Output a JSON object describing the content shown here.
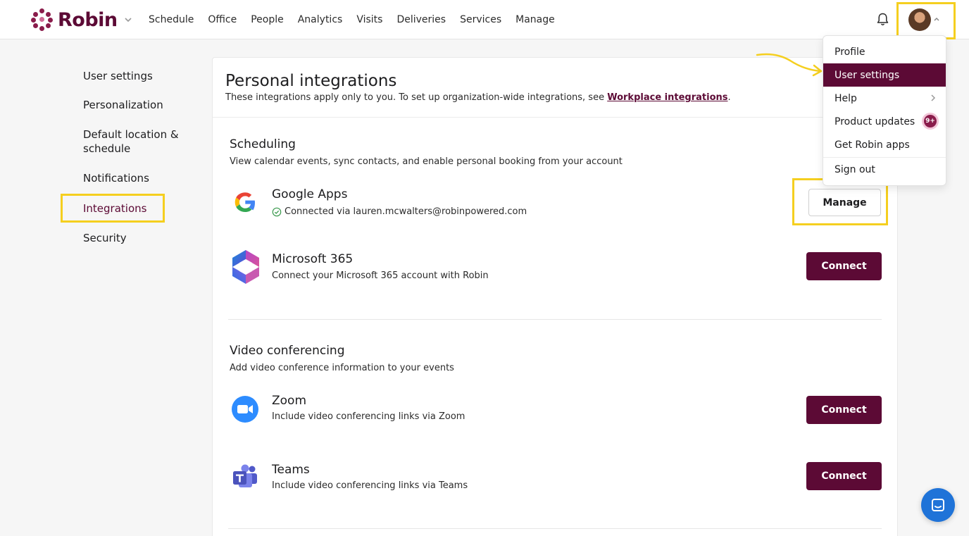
{
  "app": {
    "name": "Robin"
  },
  "nav": [
    "Schedule",
    "Office",
    "People",
    "Analytics",
    "Visits",
    "Deliveries",
    "Services",
    "Manage"
  ],
  "sidebar": {
    "items": [
      {
        "label": "User settings"
      },
      {
        "label": "Personalization"
      },
      {
        "label": "Default location & schedule"
      },
      {
        "label": "Notifications"
      },
      {
        "label": "Integrations"
      },
      {
        "label": "Security"
      }
    ],
    "active": "Integrations"
  },
  "page": {
    "title": "Personal integrations",
    "subtitle_prefix": "These integrations apply only to you. To set up organization-wide integrations, see ",
    "subtitle_link": "Workplace integrations",
    "subtitle_suffix": "."
  },
  "sections": {
    "scheduling": {
      "title": "Scheduling",
      "description": "View calendar events, sync contacts, and enable personal booking from your account",
      "google": {
        "name": "Google Apps",
        "status": "Connected via lauren.mcwalters@robinpowered.com",
        "action": "Manage"
      },
      "microsoft": {
        "name": "Microsoft 365",
        "description": "Connect your Microsoft 365 account with Robin",
        "action": "Connect"
      }
    },
    "video": {
      "title": "Video conferencing",
      "description": "Add video conference information to your events",
      "zoom": {
        "name": "Zoom",
        "description": "Include video conferencing links via Zoom",
        "action": "Connect"
      },
      "teams": {
        "name": "Teams",
        "description": "Include video conferencing links via Teams",
        "action": "Connect"
      }
    }
  },
  "user_menu": {
    "items": [
      "Profile",
      "User settings",
      "Help",
      "Product updates",
      "Get Robin apps",
      "Sign out"
    ],
    "active": "User settings",
    "updates_badge": "9+"
  },
  "colors": {
    "brand": "#5c0a35",
    "highlight": "#f5cf1f"
  }
}
